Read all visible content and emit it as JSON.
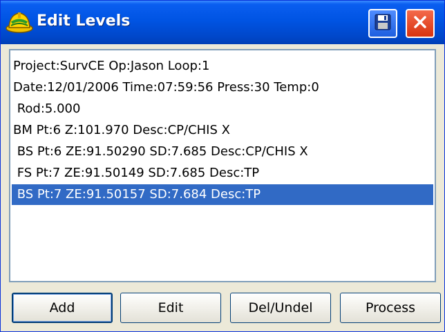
{
  "window": {
    "title": "Edit Levels",
    "app_icon": "hardhat-icon",
    "save_icon": "floppy-disk-icon",
    "close_icon": "close-x-icon",
    "accent_color": "#0054e3",
    "close_color": "#d8330f",
    "selection_color": "#316ac5"
  },
  "list": {
    "rows": [
      {
        "text": "Project:SurvCE Op:Jason Loop:1",
        "selected": false
      },
      {
        "text": "Date:12/01/2006 Time:07:59:56 Press:30 Temp:0",
        "selected": false
      },
      {
        "text": " Rod:5.000",
        "selected": false
      },
      {
        "text": "BM Pt:6 Z:101.970 Desc:CP/CHIS X",
        "selected": false
      },
      {
        "text": " BS Pt:6 ZE:91.50290 SD:7.685 Desc:CP/CHIS X",
        "selected": false
      },
      {
        "text": " FS Pt:7 ZE:91.50149 SD:7.685 Desc:TP",
        "selected": false
      },
      {
        "text": " BS Pt:7 ZE:91.50157 SD:7.684 Desc:TP",
        "selected": true
      }
    ]
  },
  "buttons": {
    "add": "Add",
    "edit": "Edit",
    "del_undel": "Del/Undel",
    "process": "Process"
  }
}
